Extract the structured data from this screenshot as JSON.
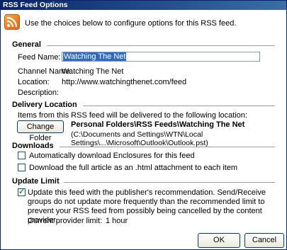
{
  "window": {
    "title": "RSS Feed Options"
  },
  "intro": {
    "text": "Use the choices below to configure options for this RSS feed."
  },
  "icons": {
    "rss": "rss-feed-icon",
    "checkmark": "checkmark-icon"
  },
  "general": {
    "title": "General",
    "feed_name_label": "Feed Name:",
    "feed_name_value": "Watching The Net",
    "channel_name_label": "Channel Name:",
    "channel_name_value": "Watching The Net",
    "location_label": "Location:",
    "location_value": "http://www.watchingthenet.com/feed",
    "description_label": "Description:"
  },
  "delivery": {
    "title": "Delivery Location",
    "info_text": "Items from this RSS feed will be delivered to the following location:",
    "change_folder_label": "Change Folder",
    "folder_path": "Personal Folders\\RSS Feeds\\Watching The Net",
    "file_path": "(C:\\Documents and Settings\\WTN\\Local Settings\\...\\Microsoft\\Outlook\\Outlook.pst)"
  },
  "downloads": {
    "title": "Downloads",
    "option1_label": "Automatically download Enclosures for this feed",
    "option1_checked": false,
    "option2_label": "Download the full article as an .html attachment to each item",
    "option2_checked": false
  },
  "update_limit": {
    "title": "Update Limit",
    "recommendation_text": "Update this feed with the publisher's recommendation. Send/Receive groups do not update more frequently than the recommended limit to prevent your RSS feed from possibly being cancelled by the content provider.",
    "recommendation_checked": true,
    "current_limit_label": "Current provider limit:",
    "current_limit_value": "1 hour"
  },
  "buttons": {
    "ok": "OK",
    "cancel": "Cancel"
  }
}
